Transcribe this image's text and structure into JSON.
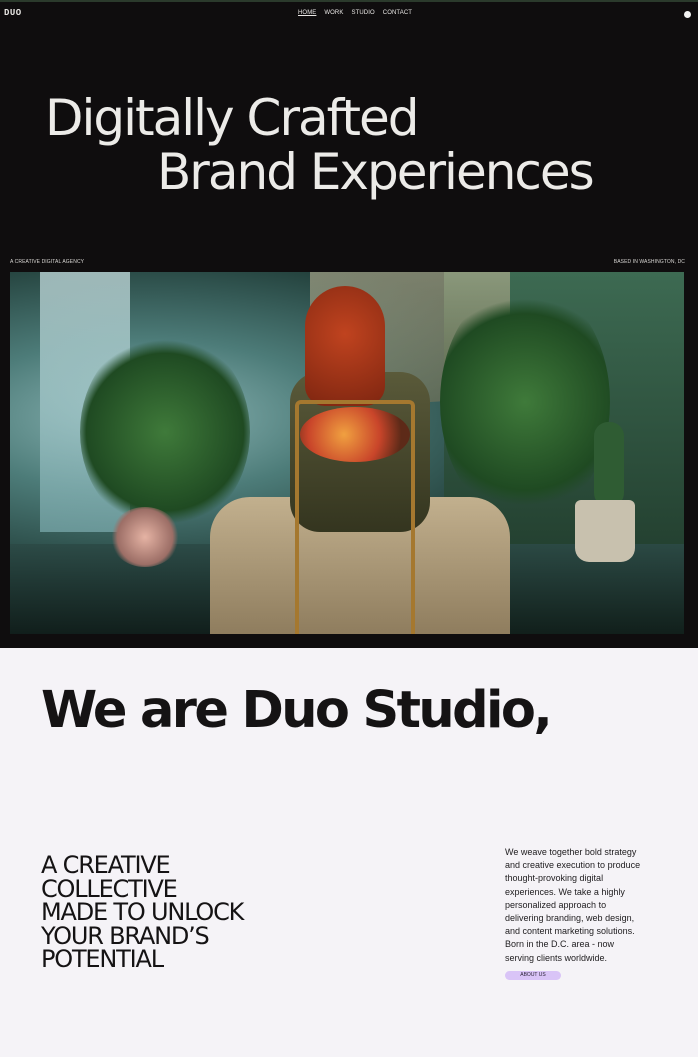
{
  "brand": {
    "logo": "DUO"
  },
  "nav": {
    "items": [
      {
        "label": "HOME",
        "active": true
      },
      {
        "label": "WORK",
        "active": false
      },
      {
        "label": "STUDIO",
        "active": false
      },
      {
        "label": "CONTACT",
        "active": false
      }
    ]
  },
  "hero": {
    "headline_line1": "Digitally Crafted",
    "headline_line2": "Brand Experiences",
    "caption_left": "A CREATIVE DIGITAL AGENCY",
    "caption_right": "BASED IN WASHINGTON, DC"
  },
  "intro": {
    "title": "We are Duo Studio,",
    "statement_lines": [
      "A CREATIVE",
      "COLLECTIVE",
      "MADE TO UNLOCK",
      "YOUR BRAND’S",
      "POTENTIAL"
    ],
    "description": "We weave together bold strategy and creative execution to produce thought-provoking digital experiences. We take a highly personalized approach to delivering branding, web design, and content marketing solutions. Born in the D.C. area - now serving clients worldwide.",
    "cta_label": "ABOUT US"
  },
  "colors": {
    "hero_bg": "#0f0d0e",
    "page_bg": "#f5f3f7",
    "accent": "#d9c4f7",
    "text_dark": "#151314",
    "text_light": "#ecebe8"
  },
  "icons": {
    "menu": "menu-dot-icon"
  }
}
